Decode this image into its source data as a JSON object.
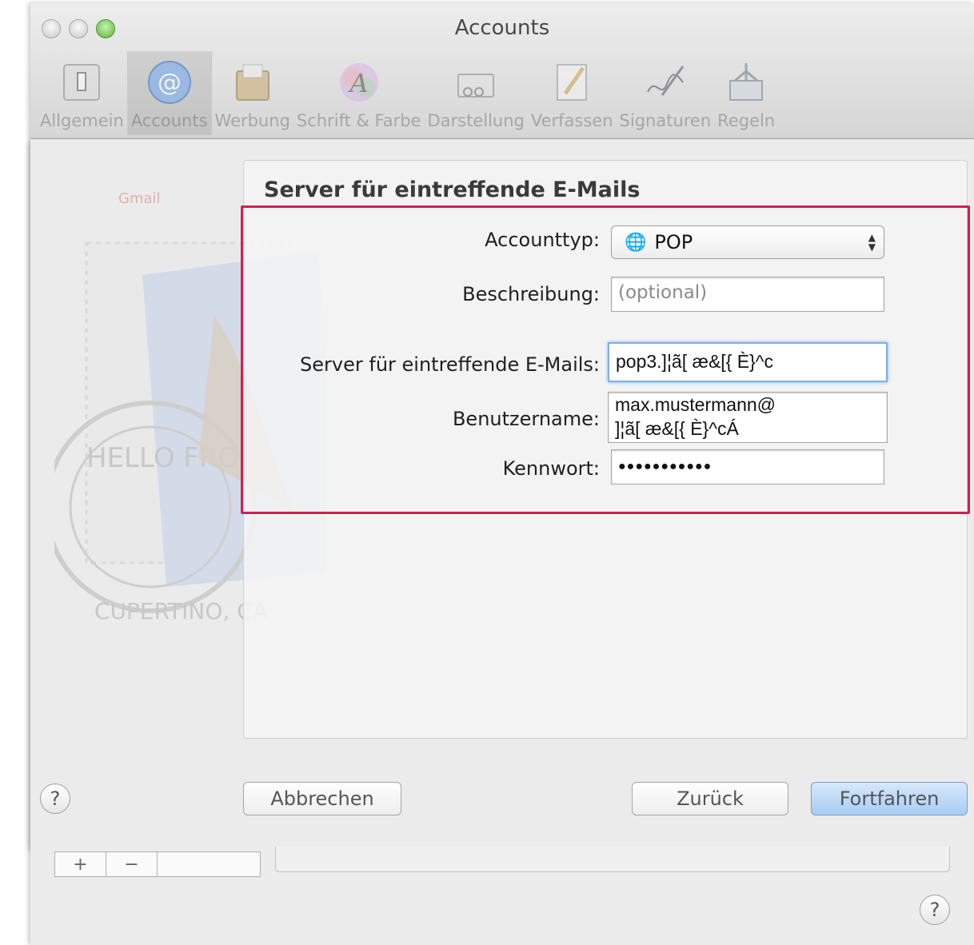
{
  "window": {
    "title": "Accounts"
  },
  "toolbar": {
    "items": [
      {
        "label": "Allgemein",
        "icon": "switch-icon"
      },
      {
        "label": "Accounts",
        "icon": "at-sign-icon"
      },
      {
        "label": "Werbung",
        "icon": "junk-mail-icon"
      },
      {
        "label": "Schrift & Farbe",
        "icon": "fonts-icon"
      },
      {
        "label": "Darstellung",
        "icon": "viewing-icon"
      },
      {
        "label": "Verfassen",
        "icon": "composing-icon"
      },
      {
        "label": "Signaturen",
        "icon": "signature-icon"
      },
      {
        "label": "Regeln",
        "icon": "rules-icon"
      }
    ],
    "active_index": 1
  },
  "sheet": {
    "section_title": "Server für eintreffende E-Mails",
    "form": {
      "account_type_label": "Accounttyp:",
      "account_type_value": "POP",
      "description_label": "Beschreibung:",
      "description_placeholder": "(optional)",
      "incoming_server_label": "Server für eintreffende E-Mails:",
      "incoming_server_value": "pop3.]¦ã[ æ&[{ È}^c",
      "username_label": "Benutzername:",
      "username_value_line1": "max.mustermann@",
      "username_value_line2": "]¦ã[ æ&[{ È}^cÁ",
      "password_label": "Kennwort:",
      "password_value": "●●●●●●●●●●●"
    },
    "buttons": {
      "help": "?",
      "cancel": "Abbrechen",
      "back": "Zurück",
      "continue": "Fortfahren"
    },
    "background_text": "Gmail",
    "stamp_text_top": "HELLO FROM",
    "stamp_text_bottom": "CUPERTINO, CA"
  },
  "bottom": {
    "add": "+",
    "remove": "−",
    "help": "?"
  },
  "colors": {
    "highlight": "#d1204f",
    "primary_button": "#a8cdf3",
    "focus_ring": "#7eaee8"
  }
}
